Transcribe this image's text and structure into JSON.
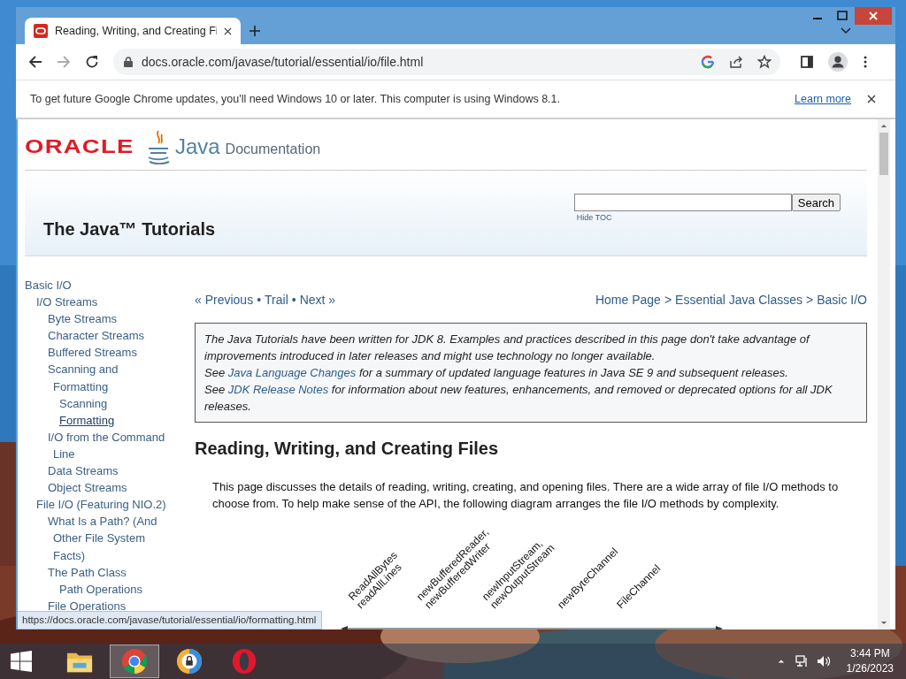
{
  "browser": {
    "tab": {
      "title": "Reading, Writing, and Creating Fi",
      "selected": true
    },
    "url": "docs.oracle.com/javase/tutorial/essential/io/file.html",
    "infobar": {
      "message": "To get future Google Chrome updates, you'll need Windows 10 or later. This computer is using Windows 8.1.",
      "link": "Learn more"
    },
    "status_url": "https://docs.oracle.com/javase/tutorial/essential/io/formatting.html"
  },
  "header": {
    "oracle": "ORACLE",
    "java": "Java",
    "documentation": "Documentation",
    "title": "The Java™ Tutorials",
    "search": {
      "button": "Search"
    },
    "hide_toc": "Hide TOC"
  },
  "toc": [
    {
      "label": "Basic I/O",
      "hovered": false,
      "children": [
        {
          "label": "I/O Streams",
          "hovered": false,
          "children": [
            {
              "label": "Byte Streams",
              "hovered": false
            },
            {
              "label": "Character Streams",
              "hovered": false
            },
            {
              "label": "Buffered Streams",
              "hovered": false
            },
            {
              "label": "Scanning and Formatting",
              "hovered": false,
              "children": [
                {
                  "label": "Scanning",
                  "hovered": false
                },
                {
                  "label": "Formatting",
                  "hovered": true
                }
              ]
            },
            {
              "label": "I/O from the Command Line",
              "hovered": false
            },
            {
              "label": "Data Streams",
              "hovered": false
            },
            {
              "label": "Object Streams",
              "hovered": false
            }
          ]
        },
        {
          "label": "File I/O (Featuring NIO.2)",
          "hovered": false,
          "children": [
            {
              "label": "What Is a Path? (And Other File System Facts)",
              "hovered": false
            },
            {
              "label": "The Path Class",
              "hovered": false,
              "children": [
                {
                  "label": "Path Operations",
                  "hovered": false
                }
              ]
            },
            {
              "label": "File Operations",
              "hovered": false
            }
          ]
        }
      ]
    }
  ],
  "nav": {
    "links": [
      "« Previous",
      "Trail",
      "Next »"
    ],
    "links_separator": "•",
    "breadcrumb": [
      "Home Page",
      "Essential Java Classes",
      "Basic I/O"
    ],
    "breadcrumb_separator": ">"
  },
  "note": [
    [
      {
        "text": "The Java Tutorials have been written for JDK 8. Examples and practices described in this page don't take advantage of improvements introduced in later releases and might use technology no longer available."
      }
    ],
    [
      {
        "text": "See "
      },
      {
        "link": "Java Language Changes"
      },
      {
        "text": " for a summary of updated language features in Java SE 9 and subsequent releases."
      }
    ],
    [
      {
        "text": "See "
      },
      {
        "link": "JDK Release Notes"
      },
      {
        "text": " for information about new features, enhancements, and removed or deprecated options for all JDK releases."
      }
    ]
  ],
  "heading": "Reading, Writing, and Creating Files",
  "intro": "This page discusses the details of reading, writing, creating, and opening files. There are a wide array of file I/O methods to choose from. To help make sense of the API, the following diagram arranges the file I/O methods by complexity.",
  "diagram": {
    "labels": [
      [
        "ReadAllBytes",
        "readAllLines"
      ],
      [
        "newBufferedReader,",
        "newBufferedWriter"
      ],
      [
        "newInputStream,",
        "newOutputStream"
      ],
      [
        "newByteChannel"
      ],
      [
        "FileChannel"
      ]
    ]
  },
  "taskbar": {
    "apps": [
      {
        "kind": "folder",
        "selected": false
      },
      {
        "kind": "chrome",
        "selected": true
      },
      {
        "kind": "shield",
        "selected": false
      },
      {
        "kind": "opera",
        "selected": false
      }
    ],
    "time": "3:44 PM",
    "date": "1/26/2023"
  }
}
